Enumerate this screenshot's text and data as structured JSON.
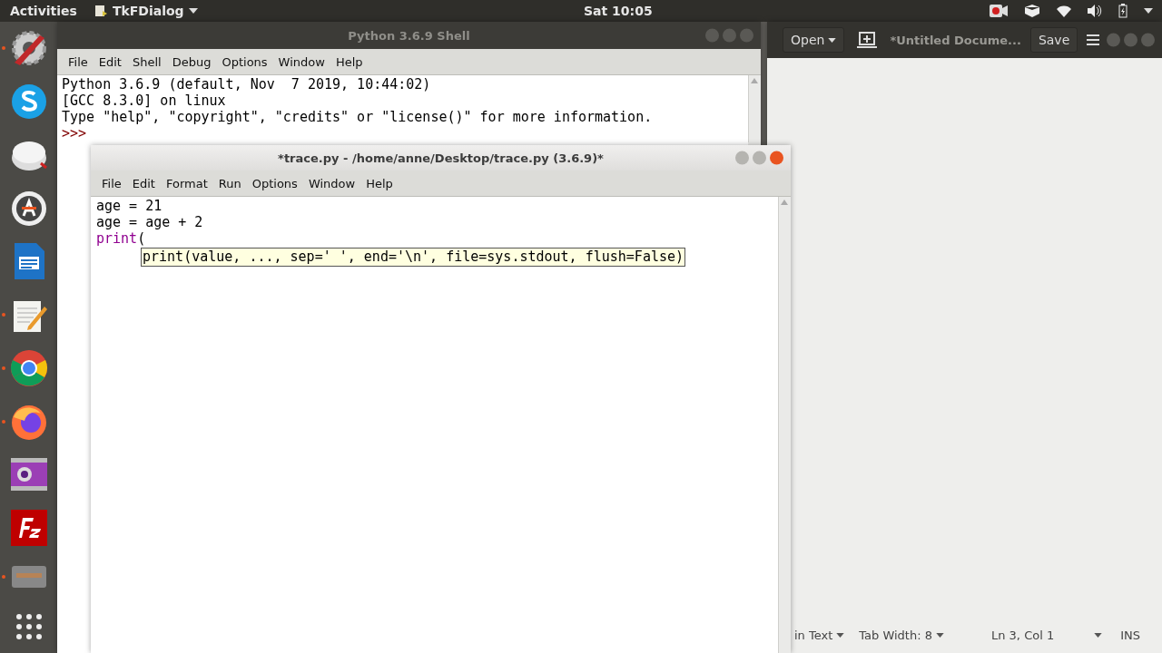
{
  "top_bar": {
    "activities": "Activities",
    "app_menu": "TkFDialog",
    "clock": "Sat 10:05"
  },
  "dock": {
    "items": [
      {
        "kind": "tools",
        "running": true
      },
      {
        "kind": "skype",
        "running": false
      },
      {
        "kind": "disc",
        "running": false
      },
      {
        "kind": "updater",
        "running": false
      },
      {
        "kind": "writer",
        "running": false
      },
      {
        "kind": "notepad",
        "running": true
      },
      {
        "kind": "chrome",
        "running": true
      },
      {
        "kind": "firefox",
        "running": true
      },
      {
        "kind": "media",
        "running": false
      },
      {
        "kind": "filezilla",
        "running": false
      },
      {
        "kind": "drawer",
        "running": true
      },
      {
        "kind": "grid",
        "running": false
      }
    ]
  },
  "shell_window": {
    "title": "Python 3.6.9 Shell",
    "menu": [
      "File",
      "Edit",
      "Shell",
      "Debug",
      "Options",
      "Window",
      "Help"
    ],
    "lines": [
      [
        {
          "text": "Python 3.6.9 (default, Nov  7 2019, 10:44:02)",
          "kind": "output"
        }
      ],
      [
        {
          "text": "[GCC 8.3.0] on linux",
          "kind": "output"
        }
      ],
      [
        {
          "text": "Type \"help\", \"copyright\", \"credits\" or \"license()\" for more information.",
          "kind": "output"
        }
      ],
      [
        {
          "text": ">>>",
          "kind": "prompt"
        }
      ]
    ]
  },
  "gedit_window": {
    "open": "Open",
    "title": "*Untitled Docume...",
    "save": "Save",
    "status": {
      "language": "in Text",
      "tab_width": "Tab Width: 8",
      "position": "Ln 3, Col 1",
      "mode": "INS"
    }
  },
  "editor_window": {
    "title": "*trace.py - /home/anne/Desktop/trace.py (3.6.9)*",
    "menu": [
      "File",
      "Edit",
      "Format",
      "Run",
      "Options",
      "Window",
      "Help"
    ],
    "lines": [
      [
        {
          "text": "age = 21",
          "kind": "plain"
        }
      ],
      [
        {
          "text": "age = age + 2",
          "kind": "plain"
        }
      ],
      [
        {
          "text": "print",
          "kind": "builtin"
        },
        {
          "text": "(",
          "kind": "plain"
        }
      ]
    ],
    "calltip": "print(value, ..., sep=' ', end='\\n', file=sys.stdout, flush=False)"
  }
}
